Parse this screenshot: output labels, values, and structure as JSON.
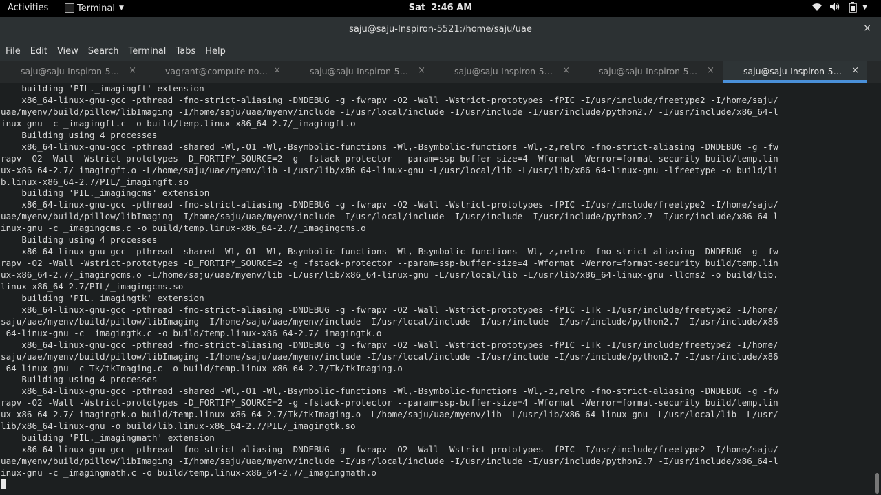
{
  "topbar": {
    "activities": "Activities",
    "app_name": "Terminal",
    "clock_day": "Sat",
    "clock_time": "2:46 AM"
  },
  "window": {
    "title": "saju@saju-Inspiron-5521:/home/saju/uae",
    "close_glyph": "×"
  },
  "menu": [
    "File",
    "Edit",
    "View",
    "Search",
    "Terminal",
    "Tabs",
    "Help"
  ],
  "tabs": [
    {
      "label": "saju@saju-Inspiron-5…",
      "active": false
    },
    {
      "label": "vagrant@compute-no…",
      "active": false
    },
    {
      "label": "saju@saju-Inspiron-5…",
      "active": false
    },
    {
      "label": "saju@saju-Inspiron-5…",
      "active": false
    },
    {
      "label": "saju@saju-Inspiron-5…",
      "active": false
    },
    {
      "label": "saju@saju-Inspiron-5…",
      "active": true
    }
  ],
  "tab_close_glyph": "×",
  "terminal": {
    "lines": [
      "    building 'PIL._imagingft' extension",
      "    x86_64-linux-gnu-gcc -pthread -fno-strict-aliasing -DNDEBUG -g -fwrapv -O2 -Wall -Wstrict-prototypes -fPIC -I/usr/include/freetype2 -I/home/saju/",
      "uae/myenv/build/pillow/libImaging -I/home/saju/uae/myenv/include -I/usr/local/include -I/usr/include -I/usr/include/python2.7 -I/usr/include/x86_64-l",
      "inux-gnu -c _imagingft.c -o build/temp.linux-x86_64-2.7/_imagingft.o",
      "    Building using 4 processes",
      "    x86_64-linux-gnu-gcc -pthread -shared -Wl,-O1 -Wl,-Bsymbolic-functions -Wl,-Bsymbolic-functions -Wl,-z,relro -fno-strict-aliasing -DNDEBUG -g -fw",
      "rapv -O2 -Wall -Wstrict-prototypes -D_FORTIFY_SOURCE=2 -g -fstack-protector --param=ssp-buffer-size=4 -Wformat -Werror=format-security build/temp.lin",
      "ux-x86_64-2.7/_imagingft.o -L/home/saju/uae/myenv/lib -L/usr/lib/x86_64-linux-gnu -L/usr/local/lib -L/usr/lib/x86_64-linux-gnu -lfreetype -o build/li",
      "b.linux-x86_64-2.7/PIL/_imagingft.so",
      "    building 'PIL._imagingcms' extension",
      "    x86_64-linux-gnu-gcc -pthread -fno-strict-aliasing -DNDEBUG -g -fwrapv -O2 -Wall -Wstrict-prototypes -fPIC -I/usr/include/freetype2 -I/home/saju/",
      "uae/myenv/build/pillow/libImaging -I/home/saju/uae/myenv/include -I/usr/local/include -I/usr/include -I/usr/include/python2.7 -I/usr/include/x86_64-l",
      "inux-gnu -c _imagingcms.c -o build/temp.linux-x86_64-2.7/_imagingcms.o",
      "    Building using 4 processes",
      "    x86_64-linux-gnu-gcc -pthread -shared -Wl,-O1 -Wl,-Bsymbolic-functions -Wl,-Bsymbolic-functions -Wl,-z,relro -fno-strict-aliasing -DNDEBUG -g -fw",
      "rapv -O2 -Wall -Wstrict-prototypes -D_FORTIFY_SOURCE=2 -g -fstack-protector --param=ssp-buffer-size=4 -Wformat -Werror=format-security build/temp.lin",
      "ux-x86_64-2.7/_imagingcms.o -L/home/saju/uae/myenv/lib -L/usr/lib/x86_64-linux-gnu -L/usr/local/lib -L/usr/lib/x86_64-linux-gnu -llcms2 -o build/lib.",
      "linux-x86_64-2.7/PIL/_imagingcms.so",
      "    building 'PIL._imagingtk' extension",
      "    x86_64-linux-gnu-gcc -pthread -fno-strict-aliasing -DNDEBUG -g -fwrapv -O2 -Wall -Wstrict-prototypes -fPIC -ITk -I/usr/include/freetype2 -I/home/",
      "saju/uae/myenv/build/pillow/libImaging -I/home/saju/uae/myenv/include -I/usr/local/include -I/usr/include -I/usr/include/python2.7 -I/usr/include/x86",
      "_64-linux-gnu -c _imagingtk.c -o build/temp.linux-x86_64-2.7/_imagingtk.o",
      "    x86_64-linux-gnu-gcc -pthread -fno-strict-aliasing -DNDEBUG -g -fwrapv -O2 -Wall -Wstrict-prototypes -fPIC -ITk -I/usr/include/freetype2 -I/home/",
      "saju/uae/myenv/build/pillow/libImaging -I/home/saju/uae/myenv/include -I/usr/local/include -I/usr/include -I/usr/include/python2.7 -I/usr/include/x86",
      "_64-linux-gnu -c Tk/tkImaging.c -o build/temp.linux-x86_64-2.7/Tk/tkImaging.o",
      "    Building using 4 processes",
      "    x86_64-linux-gnu-gcc -pthread -shared -Wl,-O1 -Wl,-Bsymbolic-functions -Wl,-Bsymbolic-functions -Wl,-z,relro -fno-strict-aliasing -DNDEBUG -g -fw",
      "rapv -O2 -Wall -Wstrict-prototypes -D_FORTIFY_SOURCE=2 -g -fstack-protector --param=ssp-buffer-size=4 -Wformat -Werror=format-security build/temp.lin",
      "ux-x86_64-2.7/_imagingtk.o build/temp.linux-x86_64-2.7/Tk/tkImaging.o -L/home/saju/uae/myenv/lib -L/usr/lib/x86_64-linux-gnu -L/usr/local/lib -L/usr/",
      "lib/x86_64-linux-gnu -o build/lib.linux-x86_64-2.7/PIL/_imagingtk.so",
      "    building 'PIL._imagingmath' extension",
      "    x86_64-linux-gnu-gcc -pthread -fno-strict-aliasing -DNDEBUG -g -fwrapv -O2 -Wall -Wstrict-prototypes -fPIC -I/usr/include/freetype2 -I/home/saju/",
      "uae/myenv/build/pillow/libImaging -I/home/saju/uae/myenv/include -I/usr/local/include -I/usr/include -I/usr/include/python2.7 -I/usr/include/x86_64-l",
      "inux-gnu -c _imagingmath.c -o build/temp.linux-x86_64-2.7/_imagingmath.o"
    ]
  }
}
